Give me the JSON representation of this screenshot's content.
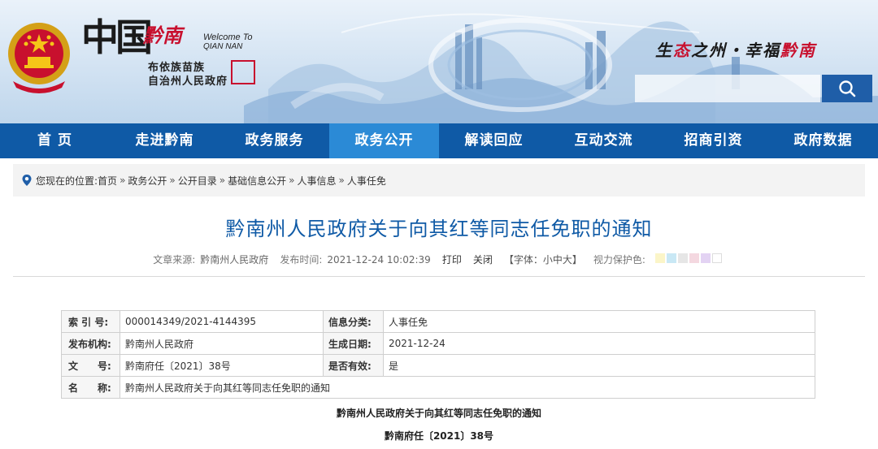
{
  "header": {
    "logo_china": "中国",
    "logo_qiannan": "黔南",
    "welcome_line1": "Welcome To",
    "welcome_line2": "QIAN NAN",
    "gov_name_line1": "布依族苗族",
    "gov_name_line2": "自治州人民政府",
    "slogan_part1": "生",
    "slogan_red1": "态",
    "slogan_part2": "之州・幸福",
    "slogan_red2": "黔南",
    "search": {
      "placeholder": "",
      "value": ""
    },
    "icons": {
      "emblem": "national-emblem-icon",
      "search": "search-icon"
    }
  },
  "nav": {
    "items": [
      {
        "label": "首 页"
      },
      {
        "label": "走进黔南"
      },
      {
        "label": "政务服务"
      },
      {
        "label": "政务公开",
        "active": true
      },
      {
        "label": "解读回应"
      },
      {
        "label": "互动交流"
      },
      {
        "label": "招商引资"
      },
      {
        "label": "政府数据"
      }
    ]
  },
  "breadcrumb": {
    "prefix": "您现在的位置:",
    "items": [
      "首页",
      "政务公开",
      "公开目录",
      "基础信息公开",
      "人事信息",
      "人事任免"
    ],
    "separator": "»"
  },
  "article": {
    "title": "黔南州人民政府关于向其红等同志任免职的通知",
    "source_label": "文章来源:",
    "source_value": "黔南州人民政府",
    "time_label": "发布时间:",
    "time_value": "2021-12-24 10:02:39",
    "print_label": "打印",
    "close_label": "关闭",
    "font_label": "【字体：小中大】",
    "eye_label": "视力保护色:",
    "eye_colors": [
      "#fbf5c8",
      "#c9e8f5",
      "#e6e6e6",
      "#f4d8e0",
      "#e3d3f3",
      "#ffffff"
    ]
  },
  "info_table": {
    "rows": [
      {
        "k1": "索 引 号:",
        "v1": "000014349/2021-4144395",
        "k2": "信息分类:",
        "v2": "人事任免"
      },
      {
        "k1": "发布机构:",
        "v1": "黔南州人民政府",
        "k2": "生成日期:",
        "v2": "2021-12-24"
      },
      {
        "k1": "文　　号:",
        "v1": "黔南府任〔2021〕38号",
        "k2": "是否有效:",
        "v2": "是"
      }
    ],
    "name_row": {
      "k": "名　　称:",
      "v": "黔南州人民政府关于向其红等同志任免职的通知"
    }
  },
  "body": {
    "doc_title": "黔南州人民政府关于向其红等同志任免职的通知",
    "doc_number": "黔南府任〔2021〕38号"
  },
  "colors": {
    "nav_bg": "#0f5aa6",
    "nav_active": "#2b8ad6",
    "title_blue": "#0f5aa6",
    "accent_red": "#c8102e"
  }
}
